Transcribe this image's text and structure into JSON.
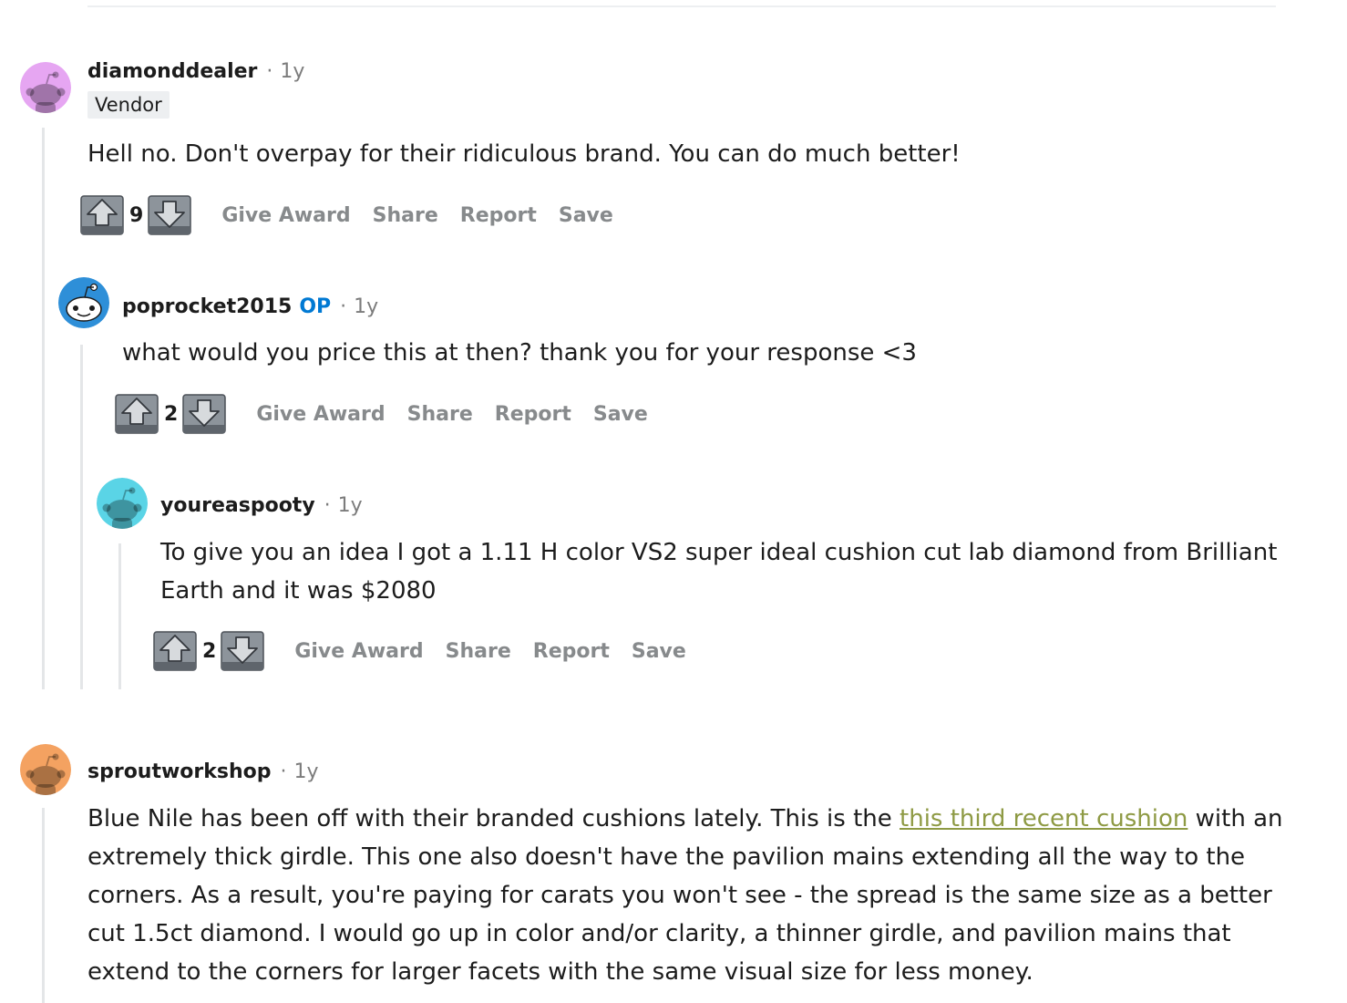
{
  "comments": [
    {
      "username": "diamonddealer",
      "age": "1y",
      "flair": "Vendor",
      "avatar_color": "#e6a6f2",
      "body": "Hell no. Don't overpay for their ridiculous brand. You can do much better!",
      "score": "9"
    },
    {
      "username": "poprocket2015",
      "op_badge": "OP",
      "age": "1y",
      "avatar_color": "#2e8fd8",
      "body": "what would you price this at then? thank you for your response <3",
      "score": "2"
    },
    {
      "username": "youreaspooty",
      "age": "1y",
      "avatar_color": "#5ad4e6",
      "body": "To give you an idea I got a 1.11 H color VS2 super ideal cushion cut lab diamond from Brilliant Earth and it was $2080",
      "score": "2"
    },
    {
      "username": "sproutworkshop",
      "age": "1y",
      "avatar_color": "#f4a261",
      "body_before": "Blue Nile has been off with their branded cushions lately. This is the ",
      "link_text": "this third recent cushion",
      "body_after": " with an extremely thick girdle. This one also doesn't have the pavilion mains extending all the way to the corners. As a result, you're paying for carats you won't see - the spread is the same size as a better cut 1.5ct diamond. I would go up in color and/or clarity, a thinner girdle, and pavilion mains that extend to the corners for larger facets with the same visual size for less money."
    }
  ],
  "actions": {
    "give_award": "Give Award",
    "share": "Share",
    "report": "Report",
    "save": "Save"
  },
  "separator": "·",
  "colors": {
    "link": "#8e9a44",
    "op": "#0079d3",
    "muted": "#878a8c"
  },
  "icons": {
    "upvote": "upvote-arrow-icon",
    "downvote": "downvote-arrow-icon",
    "avatar": "snoo-avatar-icon"
  }
}
